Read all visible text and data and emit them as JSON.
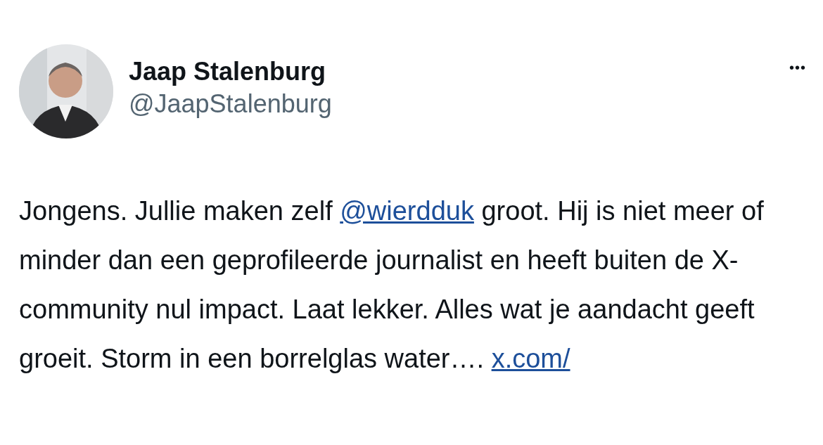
{
  "author": {
    "name": "Jaap Stalenburg",
    "handle": "@JaapStalenburg"
  },
  "menu": {
    "label": "•••"
  },
  "body": [
    {
      "kind": "text",
      "text": "Jongens. Jullie maken zelf "
    },
    {
      "kind": "link",
      "text": "@wierdduk"
    },
    {
      "kind": "text",
      "text": " groot. Hij is niet meer of minder dan een geprofileerde journalist en heeft buiten de X-community nul impact. Laat lekker. Alles wat je aandacht geeft groeit. Storm in een borrelglas water…. "
    },
    {
      "kind": "link",
      "text": "x.com/"
    }
  ]
}
